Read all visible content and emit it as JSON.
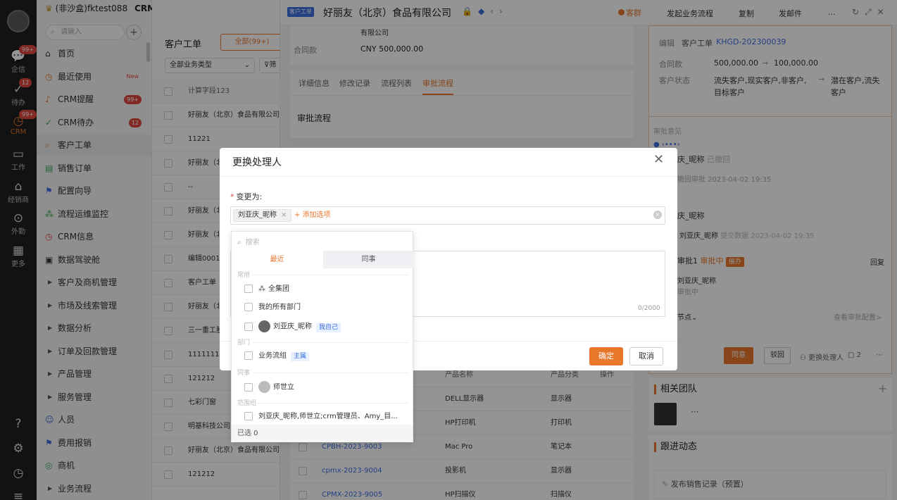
{
  "rail": {
    "items": [
      {
        "icon": "chat-icon",
        "label": "企信",
        "badge": "99+"
      },
      {
        "icon": "check-circle-icon",
        "label": "待办",
        "badge": "12"
      },
      {
        "icon": "clock-icon",
        "label": "CRM",
        "badge": "99+"
      },
      {
        "icon": "briefcase-icon",
        "label": "工作",
        "badge": ""
      },
      {
        "icon": "store-icon",
        "label": "经销商",
        "badge": ""
      },
      {
        "icon": "location-icon",
        "label": "外勤",
        "badge": ""
      },
      {
        "icon": "grid-icon",
        "label": "更多",
        "badge": ""
      }
    ],
    "accent": "#e8772c"
  },
  "nav": {
    "brand": "(非沙盒)fktest088",
    "app": "CRM",
    "search_placeholder": "请输入",
    "items": [
      {
        "label": "首页",
        "icon": "home-icon"
      },
      {
        "label": "最近使用",
        "icon": "clock-icon",
        "tag": "New"
      },
      {
        "label": "CRM提醒",
        "icon": "bell-icon",
        "badge": "99+"
      },
      {
        "label": "CRM待办",
        "icon": "check-circle-icon",
        "badge": "12"
      },
      {
        "label": "客户工单",
        "icon": "search-doc-icon"
      },
      {
        "label": "销售订单",
        "icon": "order-icon"
      },
      {
        "label": "配置向导",
        "icon": "flag-icon"
      },
      {
        "label": "流程运维监控",
        "icon": "flow-icon"
      },
      {
        "label": "CRM信息",
        "icon": "clock-icon"
      },
      {
        "label": "数据驾驶舱",
        "icon": "dashboard-icon"
      },
      {
        "label": "客户及商机管理",
        "icon": "caret-right-icon"
      },
      {
        "label": "市场及线索管理",
        "icon": "caret-right-icon"
      },
      {
        "label": "数据分析",
        "icon": "caret-right-icon"
      },
      {
        "label": "订单及回款管理",
        "icon": "caret-right-icon"
      },
      {
        "label": "产品管理",
        "icon": "caret-right-icon"
      },
      {
        "label": "服务管理",
        "icon": "caret-right-icon"
      },
      {
        "label": "人员",
        "icon": "users-icon"
      },
      {
        "label": "费用报销",
        "icon": "flag-icon"
      },
      {
        "label": "商机",
        "icon": "target-icon"
      },
      {
        "label": "业务流程",
        "icon": "caret-right-icon"
      }
    ]
  },
  "list": {
    "title": "客户工单",
    "all_button": "全部(99+)",
    "type_select": "全部业务类型",
    "filter": "筛",
    "header": "计算字段123",
    "rows": [
      "好丽友（北京）食品有限公司",
      "11221",
      "好丽友（北",
      "--",
      "好丽友（北",
      "好丽友（北",
      "编辑0001",
      "客户工单",
      "好丽友（北",
      "三一重工股",
      "1111111111",
      "121212",
      "七彩门窗",
      "明基科技公司",
      "好丽友（北京）食品有限公司",
      "121212"
    ]
  },
  "detail": {
    "tag": "客户工单",
    "name": "好丽友（北京）食品有限公司",
    "status": "客群",
    "info_line1": "有限公司",
    "contract_label": "合同款",
    "contract_value": "CNY 500,000.00",
    "tabs": [
      "详细信息",
      "修改记录",
      "流程列表",
      "审批流程"
    ],
    "section_title": "审批流程",
    "product_header": {
      "name": "产品名称",
      "category": "产品分类",
      "action": "操作"
    },
    "products": [
      {
        "code": "",
        "name": "DELL显示器",
        "category": "显示器"
      },
      {
        "code": "",
        "name": "HP打印机",
        "category": "打印机"
      },
      {
        "code": "CPBH-2023-9003",
        "name": "Mac Pro",
        "category": "笔记本"
      },
      {
        "code": "cpmx-2023-9004",
        "name": "投影机",
        "category": "显示器"
      },
      {
        "code": "CPMX-2023-9005",
        "name": "HP扫描仪",
        "category": "扫描仪"
      }
    ]
  },
  "right": {
    "buttons": [
      "发起业务流程",
      "复制",
      "发邮件",
      "..."
    ],
    "fields": [
      {
        "k": "编辑",
        "v": "客户工单 KHGD-202300039"
      },
      {
        "k": "合同款",
        "v": "500,000.00 → 100,000.00"
      },
      {
        "k": "客户状态",
        "v": "流失客户,现实客户,非客户,目标客户 → 潜在客户,流失客户"
      }
    ],
    "edit_label": "编辑",
    "edit_prefix": "客户工单",
    "edit_code": "KHGD-202300039",
    "amount_label": "合同款",
    "amount_from": "500,000.00",
    "amount_to": "100,000.00",
    "status_label": "客户状态",
    "status_from_1": "流失客户,现实客户,非客户,",
    "status_from_2": "目标客户",
    "status_to_1": "潜在客户,流失",
    "status_to_2": "客户",
    "approval_title": "审批意见",
    "log": {
      "n1": "庆_昵称",
      "n1_status": "已撤回",
      "n1_action": "撤回审批",
      "n1_time": "2023-04-02 19:35",
      "n2": "庆_昵称",
      "n3_user": "刘亚庆_昵称",
      "n3_action": "提交数据",
      "n3_time": "2023-04-02 19:35",
      "stage": "审批1",
      "stage_status": "审批中",
      "stage_tag": "催办",
      "reply": "回复",
      "stage_user": "刘亚庆_昵称",
      "stage_sub": "审批中",
      "node_link": "节点",
      "config_link": "查看审批配置>"
    },
    "agree": "同意",
    "reject": "驳回",
    "change_handler": "更换处理人",
    "comment_count": "2",
    "team_title": "相关团队",
    "activity_title": "跟进动态",
    "activity_item": "发布销售记录（预置）"
  },
  "dialog": {
    "title": "更换处理人",
    "field_label": "变更为:",
    "chip": "刘亚庆_昵称",
    "add_option": "+ 添加选项",
    "counter": "0/2000",
    "ok": "确定",
    "cancel": "取消"
  },
  "dropdown": {
    "search_placeholder": "搜索",
    "tab_recent": "最近",
    "tab_colleague": "同事",
    "groups": {
      "common": "常用",
      "dept": "部门",
      "colleague": "同事",
      "scope": "范围组"
    },
    "opt_all": "全集团",
    "opt_my_depts": "我的所有部门",
    "opt_me": "刘亚庆_昵称",
    "opt_me_tag": "我自己",
    "opt_dept": "业务流组",
    "opt_dept_tag": "主属",
    "opt_colleague": "师世立",
    "opt_scope": "刘亚庆_昵称,师世立;crm管理员、Amy_目...",
    "selected": "已选 0"
  }
}
